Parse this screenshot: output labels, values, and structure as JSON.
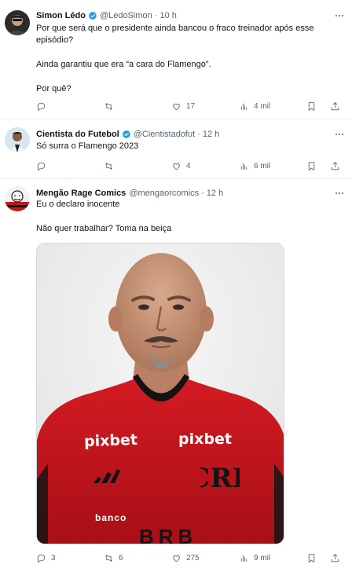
{
  "tweets": [
    {
      "name": "Simon Lédo",
      "handle": "@LedoSimon",
      "time": "10 h",
      "lines": [
        "Por que será que o presidente ainda bancou o fraco treinador após esse episódio?",
        "Ainda garantiu que era “a cara do Flamengo”.",
        "Por quê?"
      ],
      "reply_count": "",
      "retweet_count": "",
      "like_count": "17",
      "view_count": "4 mil"
    },
    {
      "name": "Cientista do Futebol",
      "handle": "@Cientistadofut",
      "time": "12 h",
      "lines": [
        "Só surra o Flamengo 2023"
      ],
      "reply_count": "",
      "retweet_count": "",
      "like_count": "4",
      "view_count": "6 mil"
    },
    {
      "name": "Mengão Rage Comics",
      "handle": "@mengaorcomics",
      "time": "12 h",
      "lines": [
        "Eu o declaro inocente",
        "Não quer trabalhar? Toma na beiça"
      ],
      "reply_count": "3",
      "retweet_count": "6",
      "like_count": "275",
      "view_count": "9 mil"
    }
  ],
  "media": {
    "shirt_sponsor_left": "pixbet",
    "shirt_sponsor_right": "pixbet",
    "shirt_bank": "banco",
    "shirt_bank_brand": "BRB"
  },
  "colors": {
    "verified": "#1d9bf0",
    "secondary_text": "#536471",
    "jersey_red": "#c4161c",
    "divider": "#e6ecf0"
  }
}
